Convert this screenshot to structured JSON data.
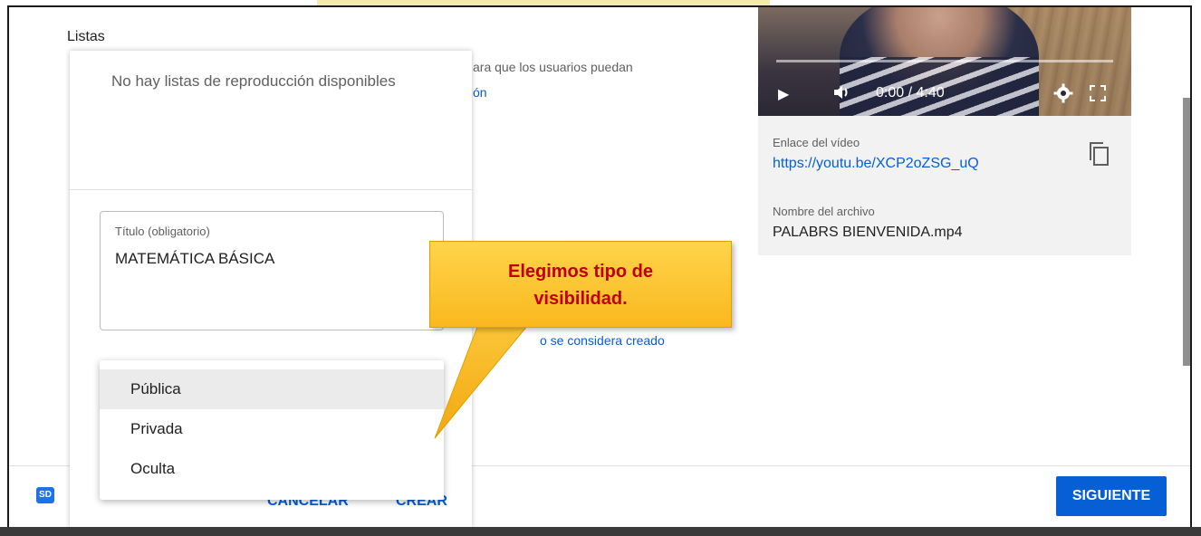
{
  "page": {
    "section_label": "Listas",
    "background_text_1": "ara que los usuarios puedan",
    "background_text_2": "ón",
    "background_text_3": "o se considera creado"
  },
  "video": {
    "time": "0:00 / 4:40",
    "link_label": "Enlace del vídeo",
    "link": "https://youtu.be/XCP2oZSG_uQ",
    "file_label": "Nombre del archivo",
    "file_name": "PALABRS BIENVENIDA.mp4",
    "icons": [
      "play-icon",
      "volume-icon",
      "settings-icon",
      "fullscreen-icon",
      "copy-icon"
    ]
  },
  "playlist_dialog": {
    "empty_message": "No hay listas de reproducción disponibles",
    "title_label": "Título (obligatorio)",
    "title_value": "MATEMÁTICA BÁSICA",
    "cancel_label": "CANCELAR",
    "create_label": "CREAR",
    "visibility_options": [
      "Pública",
      "Privada",
      "Oculta"
    ],
    "selected_visibility": "Pública"
  },
  "callout": {
    "line1": "Elegimos tipo de",
    "line2": "visibilidad."
  },
  "footer": {
    "badge": "SD",
    "next_label": "SIGUIENTE"
  },
  "colors": {
    "accent": "#065fd4",
    "callout_text": "#c00000",
    "callout_fill": "#f9b81f"
  }
}
